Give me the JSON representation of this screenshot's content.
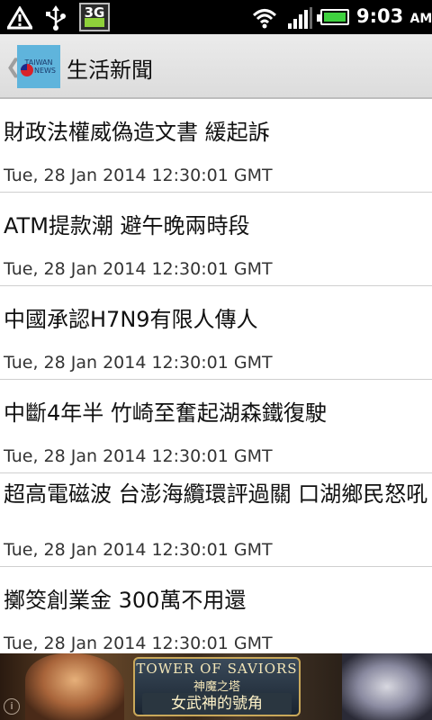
{
  "status_bar": {
    "network_type": "3G",
    "time": "9:03",
    "ampm": "AM",
    "icons": [
      "warning-icon",
      "usb-icon",
      "3g-data-icon",
      "wifi-icon",
      "signal-icon",
      "battery-icon"
    ]
  },
  "header": {
    "title": "生活新聞",
    "logo_line1": "TAIWAN",
    "logo_line2": "NEWS",
    "back_glyph": "❮"
  },
  "news": [
    {
      "headline": "財政法權威偽造文書 緩起訴",
      "date": "Tue, 28 Jan 2014 12:30:01 GMT"
    },
    {
      "headline": "ATM提款潮 避午晚兩時段",
      "date": "Tue, 28 Jan 2014 12:30:01 GMT"
    },
    {
      "headline": "中國承認H7N9有限人傳人",
      "date": "Tue, 28 Jan 2014 12:30:01 GMT"
    },
    {
      "headline": "中斷4年半 竹崎至奮起湖森鐵復駛",
      "date": "Tue, 28 Jan 2014 12:30:01 GMT"
    },
    {
      "headline": "超高電磁波 台澎海纜環評過關 口湖鄉民怒吼",
      "date": "Tue, 28 Jan 2014 12:30:01 GMT"
    },
    {
      "headline": "擲筊創業金 300萬不用還",
      "date": "Tue, 28 Jan 2014 12:30:01 GMT"
    }
  ],
  "ad": {
    "title": "TOWER OF SAVIORS",
    "subtitle": "神魔之塔",
    "tagline": "女武神的號角",
    "info_glyph": "i"
  }
}
